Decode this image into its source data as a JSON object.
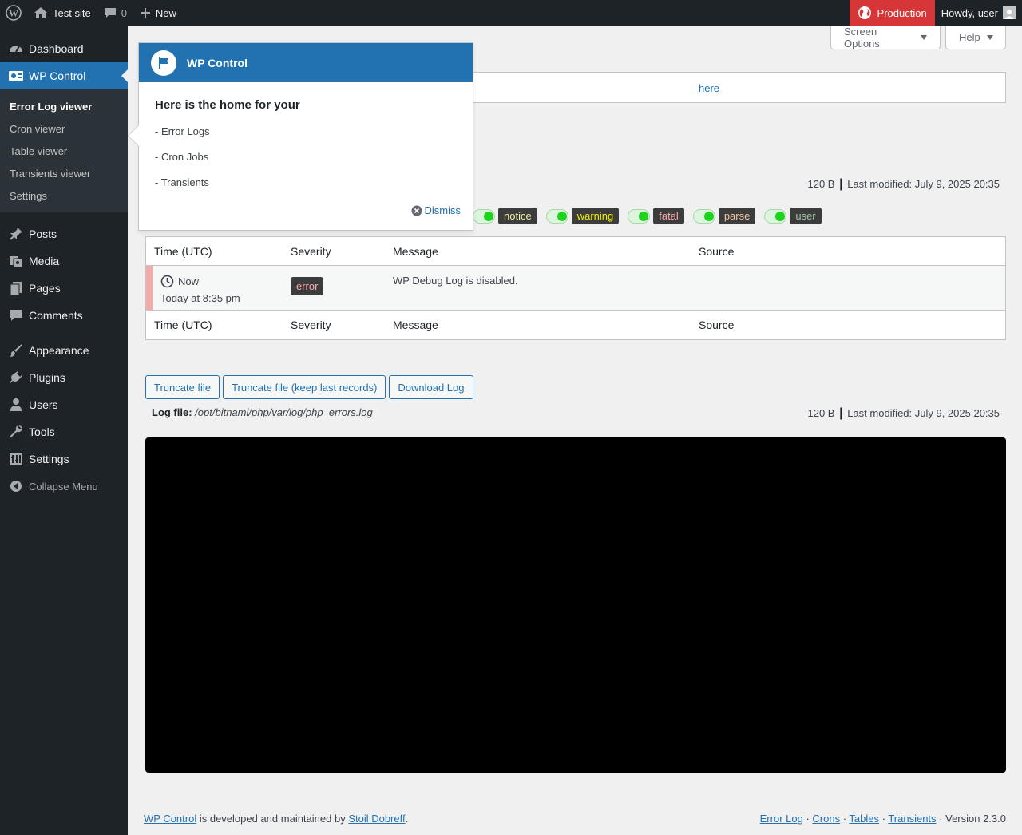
{
  "adminbar": {
    "site_name": "Test site",
    "comments_count": "0",
    "new_label": "New",
    "environment": "Production",
    "howdy": "Howdy, user"
  },
  "sidebar": {
    "items": [
      {
        "label": "Dashboard",
        "icon": "dashboard-icon"
      },
      {
        "label": "WP Control",
        "icon": "wp-control-icon"
      },
      {
        "label": "Posts",
        "icon": "pin-icon"
      },
      {
        "label": "Media",
        "icon": "media-icon"
      },
      {
        "label": "Pages",
        "icon": "pages-icon"
      },
      {
        "label": "Comments",
        "icon": "comment-icon"
      },
      {
        "label": "Appearance",
        "icon": "brush-icon"
      },
      {
        "label": "Plugins",
        "icon": "plug-icon"
      },
      {
        "label": "Users",
        "icon": "user-icon"
      },
      {
        "label": "Tools",
        "icon": "wrench-icon"
      },
      {
        "label": "Settings",
        "icon": "settings-icon"
      }
    ],
    "submenu": [
      "Error Log viewer",
      "Cron viewer",
      "Table viewer",
      "Transients viewer",
      "Settings"
    ],
    "collapse": "Collapse Menu"
  },
  "header": {
    "screen_options": "Screen Options",
    "help": "Help"
  },
  "notice": {
    "link": "here"
  },
  "file_meta": {
    "size": "120 B",
    "separator": "|",
    "modified": "Last modified: July 9, 2025 20:35"
  },
  "filters": [
    {
      "label": "notice",
      "color": "#f0f0a0"
    },
    {
      "label": "warning",
      "color": "#f0f000"
    },
    {
      "label": "fatal",
      "color": "#f7a9a9"
    },
    {
      "label": "parse",
      "color": "#f7c59f"
    },
    {
      "label": "user",
      "color": "#9ec79e"
    }
  ],
  "table": {
    "headers": [
      "Time (UTC)",
      "Severity",
      "Message",
      "Source"
    ],
    "rows": [
      {
        "time": "Now",
        "when": "Today at 8:35 pm",
        "severity": "error",
        "message": "WP Debug Log is disabled.",
        "source": ""
      }
    ]
  },
  "actions": {
    "truncate": "Truncate file",
    "truncate_keep": "Truncate file (keep last records)",
    "download": "Download Log"
  },
  "logfile": {
    "label": "Log file:",
    "path": "/opt/bitnami/php/var/log/php_errors.log"
  },
  "footer": {
    "plugin_link": "WP Control",
    "middle": " is developed and maintained by ",
    "author": "Stoil Dobreff",
    "end": ".",
    "links": [
      "Error Log",
      "Crons",
      "Tables",
      "Transients"
    ],
    "dot": " · ",
    "version": "Version 2.3.0"
  },
  "pointer": {
    "title": "WP Control",
    "heading": "Here is the home for your",
    "items": [
      "- Error Logs",
      "- Cron Jobs",
      "- Transients"
    ],
    "dismiss": "Dismiss"
  }
}
